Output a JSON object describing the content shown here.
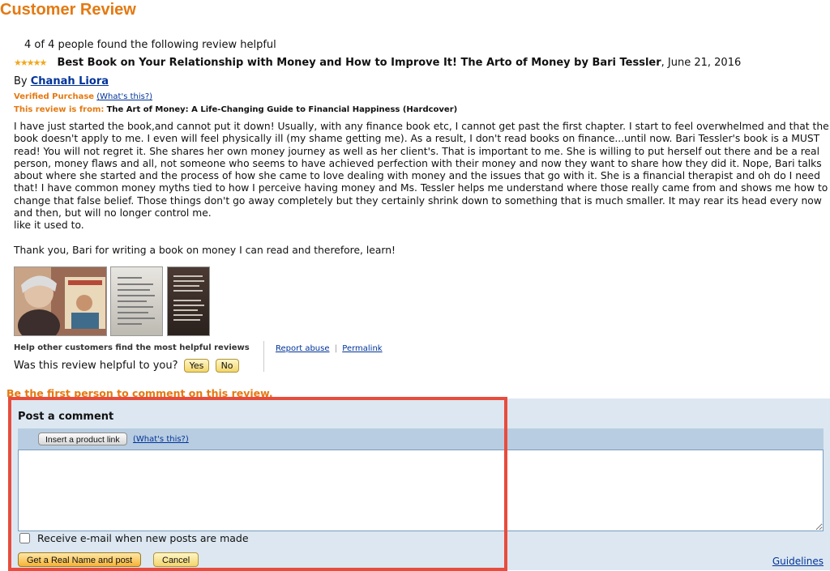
{
  "page": {
    "title": "Customer Review"
  },
  "review": {
    "helpful_count_text": "4 of 4 people found the following review helpful",
    "stars_glyph": "★★★★★",
    "headline": "Best Book on Your Relationship with Money and How to Improve It! The Arto of Money by Bari Tessler",
    "date": ", June 21, 2016",
    "by_label": "By",
    "author": "Chanah Liora",
    "verified_label": "Verified Purchase",
    "whats_this": "(What's this?)",
    "review_from_label": "This review is from:",
    "product_name": "The Art of Money: A Life-Changing Guide to Financial Happiness (Hardcover)",
    "body": "I have just started the book,and cannot put it down! Usually, with any finance book etc, I cannot get past the first chapter. I start to feel overwhelmed and that the book doesn't apply to me. I even will feel physically ill (my shame getting me). As a result, I don't read books on finance...until now. Bari Tessler's book is a MUST read! You will not regret it. She shares her own money journey as well as her client's. That is important to me. She is willing to put herself out there and be a real person, money flaws and all, not someone who seems to have achieved perfection with their money and now they want to share how they did it. Nope, Bari talks about where she started and the process of how she came to love dealing with money and the issues that go with it. She is a financial therapist and oh do I need that! I have common money myths tied to how I perceive having money and Ms. Tessler helps me understand where those really came from and shows me how to change that false belief. Those things don't go away completely but they certainly shrink down to something that is much smaller. It may rear its head every now and then, but will no longer control me.",
    "body_tail": "like it used to.",
    "thanks": "Thank you, Bari for writing a book on money I can read and therefore, learn!"
  },
  "feedback": {
    "help_label": "Help other customers find the most helpful reviews",
    "question": "Was this review helpful to you?",
    "yes": "Yes",
    "no": "No",
    "report_abuse": "Report abuse",
    "separator": "|",
    "permalink": "Permalink"
  },
  "comments": {
    "first_comment_prompt": "Be the first person to comment on this review.",
    "post_title": "Post a comment",
    "insert_product_link": "Insert a product link",
    "whats_this": "(What's this?)",
    "textarea_value": "",
    "email_checkbox_label": "Receive e-mail when new posts are made",
    "email_checked": false,
    "post_button": "Get a Real Name and post",
    "cancel_button": "Cancel",
    "guidelines": "Guidelines"
  },
  "colors": {
    "accent_orange": "#e47911",
    "link_blue": "#003399",
    "panel_blue": "#dce7f1",
    "highlight_red": "#e84c3d"
  }
}
